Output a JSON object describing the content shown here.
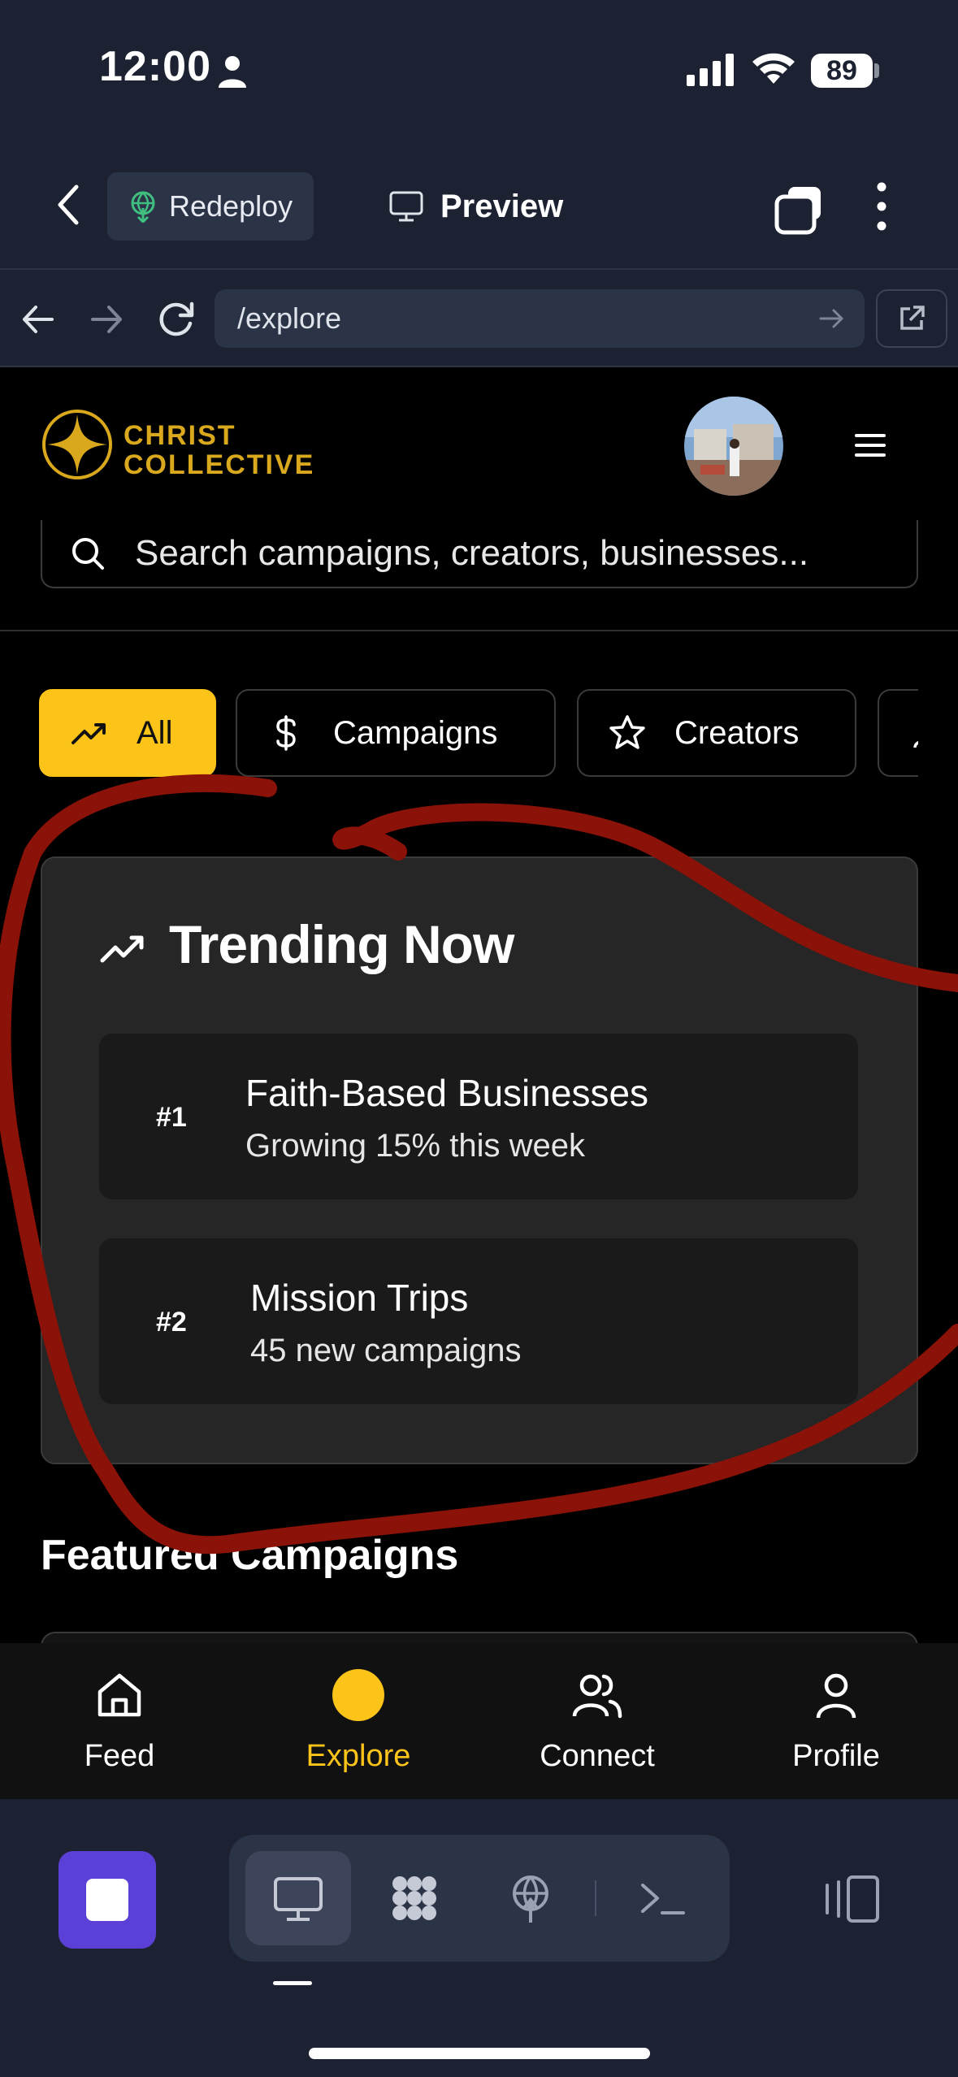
{
  "status_bar": {
    "time": "12:00",
    "battery": "89"
  },
  "toolbar": {
    "redeploy_label": "Redeploy",
    "preview_label": "Preview"
  },
  "url_bar": {
    "url": "/explore"
  },
  "app": {
    "brand_line1": "CHRIST",
    "brand_line2": "COLLECTIVE",
    "search_placeholder": "Search campaigns, creators, businesses..."
  },
  "filters": [
    {
      "label": "All",
      "icon": "trending-icon",
      "active": true
    },
    {
      "label": "Campaigns",
      "icon": "dollar-icon",
      "active": false
    },
    {
      "label": "Creators",
      "icon": "star-icon",
      "active": false
    }
  ],
  "trending": {
    "title": "Trending Now",
    "items": [
      {
        "rank": "#1",
        "name": "Faith-Based Businesses",
        "sub": "Growing 15% this week"
      },
      {
        "rank": "#2",
        "name": "Mission Trips",
        "sub": "45 new campaigns"
      }
    ]
  },
  "featured": {
    "title": "Featured Campaigns"
  },
  "bottom_nav": [
    {
      "label": "Feed",
      "icon": "home-icon",
      "active": false
    },
    {
      "label": "Explore",
      "icon": "explore-dot-icon",
      "active": true
    },
    {
      "label": "Connect",
      "icon": "users-icon",
      "active": false
    },
    {
      "label": "Profile",
      "icon": "user-icon",
      "active": false
    }
  ],
  "colors": {
    "accent": "#fcc419",
    "brand_gold": "#d9a81d",
    "annotation": "#8b1208",
    "chrome": "#1c2232"
  }
}
